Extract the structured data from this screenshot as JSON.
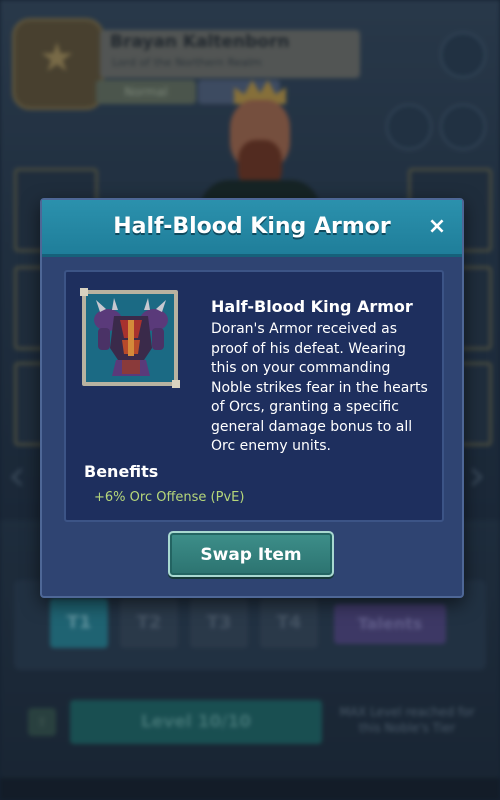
{
  "background": {
    "player_name": "Brayan Kaltenborn",
    "player_subtitle": "Lord of the Northern Realm",
    "rank_label": "Normal",
    "tiers": [
      "T1",
      "T2",
      "T3",
      "T4"
    ],
    "talents_label": "Talents",
    "level_label": "Level 10/10",
    "max_level_note": "MAX Level reached for this Noble's Tier"
  },
  "dialog": {
    "title": "Half-Blood King Armor",
    "close_glyph": "×",
    "item": {
      "name": "Half-Blood King Armor",
      "icon": "armor-icon",
      "description": "Doran's Armor received as proof of his defeat. Wearing this on your commanding Noble strikes fear in the hearts of Orcs, granting a specific general damage bonus to all Orc enemy units."
    },
    "benefits_label": "Benefits",
    "benefits": [
      "+6% Orc Offense (PvE)"
    ],
    "swap_button_label": "Swap Item"
  },
  "colors": {
    "header_teal": "#2b91ad",
    "dialog_blue": "#2f4472",
    "panel_navy": "#1e2f5e",
    "benefit_green": "#b6d77a",
    "button_teal": "#3d8f8a"
  }
}
